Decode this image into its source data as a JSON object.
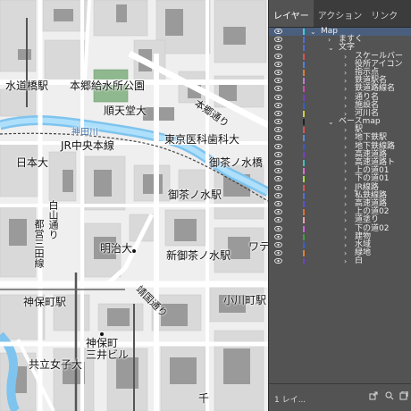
{
  "map": {
    "labels": [
      {
        "id": "suidobashi",
        "text": "水道橋駅"
      },
      {
        "id": "hongo_kyusui",
        "text": "本郷給水所公園"
      },
      {
        "id": "juntendo",
        "text": "順天堂大"
      },
      {
        "id": "hongo_dori",
        "text": "本郷通り"
      },
      {
        "id": "kandagawa",
        "text": "神田川"
      },
      {
        "id": "jr_chuo",
        "text": "JR中央本線"
      },
      {
        "id": "tmd",
        "text": "東京医科歯科大"
      },
      {
        "id": "nichidai",
        "text": "日本大"
      },
      {
        "id": "ochanomizu_st",
        "text": "御茶ノ水駅"
      },
      {
        "id": "ochanomizu_bridge",
        "text": "御茶ノ水橋"
      },
      {
        "id": "hakusan",
        "text": "白山通り"
      },
      {
        "id": "mita",
        "text": "都営三田線"
      },
      {
        "id": "meiji",
        "text": "明治大"
      },
      {
        "id": "shin_ochanomizu",
        "text": "新御茶ノ水駅"
      },
      {
        "id": "waterras",
        "text": "ワテ"
      },
      {
        "id": "yasukuni",
        "text": "靖国通り"
      },
      {
        "id": "ogawamachi",
        "text": "小川町駅"
      },
      {
        "id": "jinbocho",
        "text": "神保町駅"
      },
      {
        "id": "jinbocho_mitsui",
        "text": "神保町\n三井ビル"
      },
      {
        "id": "kyoritsu",
        "text": "共立女子大"
      },
      {
        "id": "chi",
        "text": "千"
      }
    ]
  },
  "panel": {
    "tabs": [
      "レイヤー",
      "アクション",
      "リンク"
    ],
    "footer_count": "1 レイ..."
  },
  "layers": [
    {
      "name": "Map",
      "level": 0,
      "expanded": true,
      "selected": true,
      "color": "#3fd0d8"
    },
    {
      "name": "ますく",
      "level": 1,
      "expanded": false,
      "color": "#4c6ee0"
    },
    {
      "name": "文字",
      "level": 1,
      "expanded": true,
      "color": "#4c6ee0"
    },
    {
      "name": "スケールバー",
      "level": 2,
      "expanded": false,
      "color": "#e05050"
    },
    {
      "name": "役所アイコン",
      "level": 2,
      "expanded": false,
      "color": "#4f7fe0"
    },
    {
      "name": "指示点",
      "level": 2,
      "expanded": false,
      "color": "#e07c30"
    },
    {
      "name": "鉄道駅名",
      "level": 2,
      "expanded": false,
      "color": "#c07ad0"
    },
    {
      "name": "鉄道路線名",
      "level": 2,
      "expanded": false,
      "color": "#d04ab0"
    },
    {
      "name": "通り名",
      "level": 2,
      "expanded": false,
      "color": "#7a3ad0"
    },
    {
      "name": "施設名",
      "level": 2,
      "expanded": false,
      "color": "#3060d0"
    },
    {
      "name": "河川名",
      "level": 2,
      "expanded": false,
      "color": "#d0d040"
    },
    {
      "name": "ベースmap",
      "level": 1,
      "expanded": true,
      "color": "#222222"
    },
    {
      "name": "駅",
      "level": 2,
      "expanded": false,
      "color": "#e05050"
    },
    {
      "name": "地下鉄駅",
      "level": 2,
      "expanded": false,
      "color": "#5a8ae0"
    },
    {
      "name": "地下鉄線路",
      "level": 2,
      "expanded": false,
      "color": "#3a5ad0"
    },
    {
      "name": "高速道路",
      "level": 2,
      "expanded": false,
      "color": "#7a3ad0"
    },
    {
      "name": "高速道路ト",
      "level": 2,
      "expanded": false,
      "color": "#40c0c0"
    },
    {
      "name": "上の道01",
      "level": 2,
      "expanded": false,
      "color": "#e06ad0"
    },
    {
      "name": "下の道01",
      "level": 2,
      "expanded": false,
      "color": "#a0e040"
    },
    {
      "name": "JR線路",
      "level": 2,
      "expanded": false,
      "color": "#e05050"
    },
    {
      "name": "私鉄線路",
      "level": 2,
      "expanded": false,
      "color": "#4a70e0"
    },
    {
      "name": "高速道路",
      "level": 2,
      "expanded": false,
      "color": "#5a50e0"
    },
    {
      "name": "上の道02",
      "level": 2,
      "expanded": false,
      "color": "#e07030"
    },
    {
      "name": "道塗り",
      "level": 2,
      "expanded": false,
      "color": "#f0a0b0"
    },
    {
      "name": "下の道02",
      "level": 2,
      "expanded": false,
      "color": "#d060e0"
    },
    {
      "name": "建物",
      "level": 2,
      "expanded": false,
      "color": "#40a040"
    },
    {
      "name": "水域",
      "level": 2,
      "expanded": false,
      "color": "#3a60d0"
    },
    {
      "name": "緑地",
      "level": 2,
      "expanded": false,
      "color": "#e08030"
    },
    {
      "name": "白",
      "level": 2,
      "expanded": false,
      "color": "#7040c0"
    }
  ]
}
